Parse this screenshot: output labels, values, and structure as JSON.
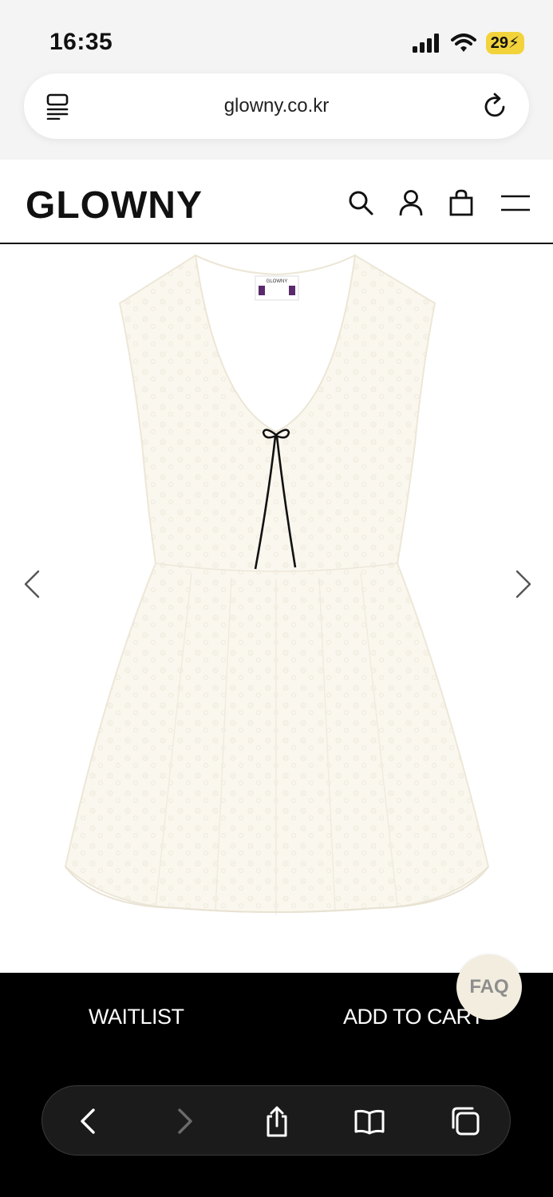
{
  "status_bar": {
    "time": "16:35",
    "battery": "29"
  },
  "browser": {
    "url": "glowny.co.kr",
    "reader_icon": "reader-icon",
    "reload_icon": "reload-icon"
  },
  "header": {
    "brand": "GLOWNY",
    "icons": [
      "search-icon",
      "account-icon",
      "bag-icon",
      "menu-icon"
    ]
  },
  "product": {
    "image_desc": "white lace sleeveless dress",
    "label_text": "GLOWNY",
    "prev_icon": "chevron-left-icon",
    "next_icon": "chevron-right-icon"
  },
  "actions": {
    "waitlist": "WAITLIST",
    "add_to_cart": "ADD TO CART",
    "faq": "FAQ"
  },
  "toolbar": {
    "icons": [
      "back-icon",
      "forward-icon",
      "share-icon",
      "bookmarks-icon",
      "tabs-icon"
    ]
  },
  "colors": {
    "battery": "#f3d33b",
    "faq_bg": "#f2edde",
    "action_bar": "#000000",
    "dress": "#faf7ee",
    "bow": "#111111"
  }
}
